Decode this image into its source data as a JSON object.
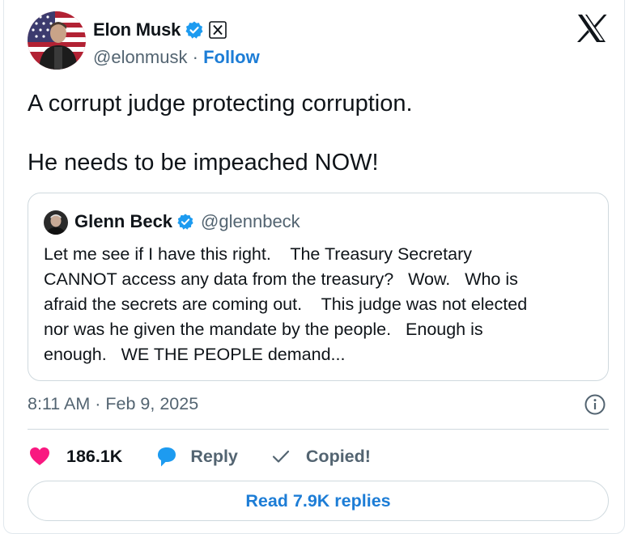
{
  "author": {
    "name": "Elon Musk",
    "handle": "@elonmusk",
    "separator": " · ",
    "follow_label": "Follow"
  },
  "tweet": {
    "lines": [
      "A corrupt judge protecting corruption.",
      "He needs to be impeached NOW!"
    ]
  },
  "quoted": {
    "name": "Glenn Beck",
    "handle": "@glennbeck",
    "text": "Let me see if I have this right.    The Treasury Secretary\nCANNOT access any data from the treasury?   Wow.   Who is\nafraid the secrets are coming out.    This judge was not elected\nnor was he given the mandate by the people.   Enough is\nenough.   WE THE PEOPLE demand..."
  },
  "timestamp": "8:11 AM · Feb 9, 2025",
  "actions": {
    "likes": "186.1K",
    "reply_label": "Reply",
    "copied_label": "Copied!"
  },
  "read_replies_label": "Read 7.9K replies",
  "icons": {
    "verified": "verified-badge-icon",
    "x_logo": "x-logo-icon",
    "info": "info-icon",
    "like": "heart-icon",
    "reply": "speech-bubble-icon",
    "copied": "checkmark-icon"
  },
  "colors": {
    "accent": "#1d7dd6",
    "verified": "#1d9bf0",
    "like": "#f91880",
    "muted": "#536471"
  }
}
